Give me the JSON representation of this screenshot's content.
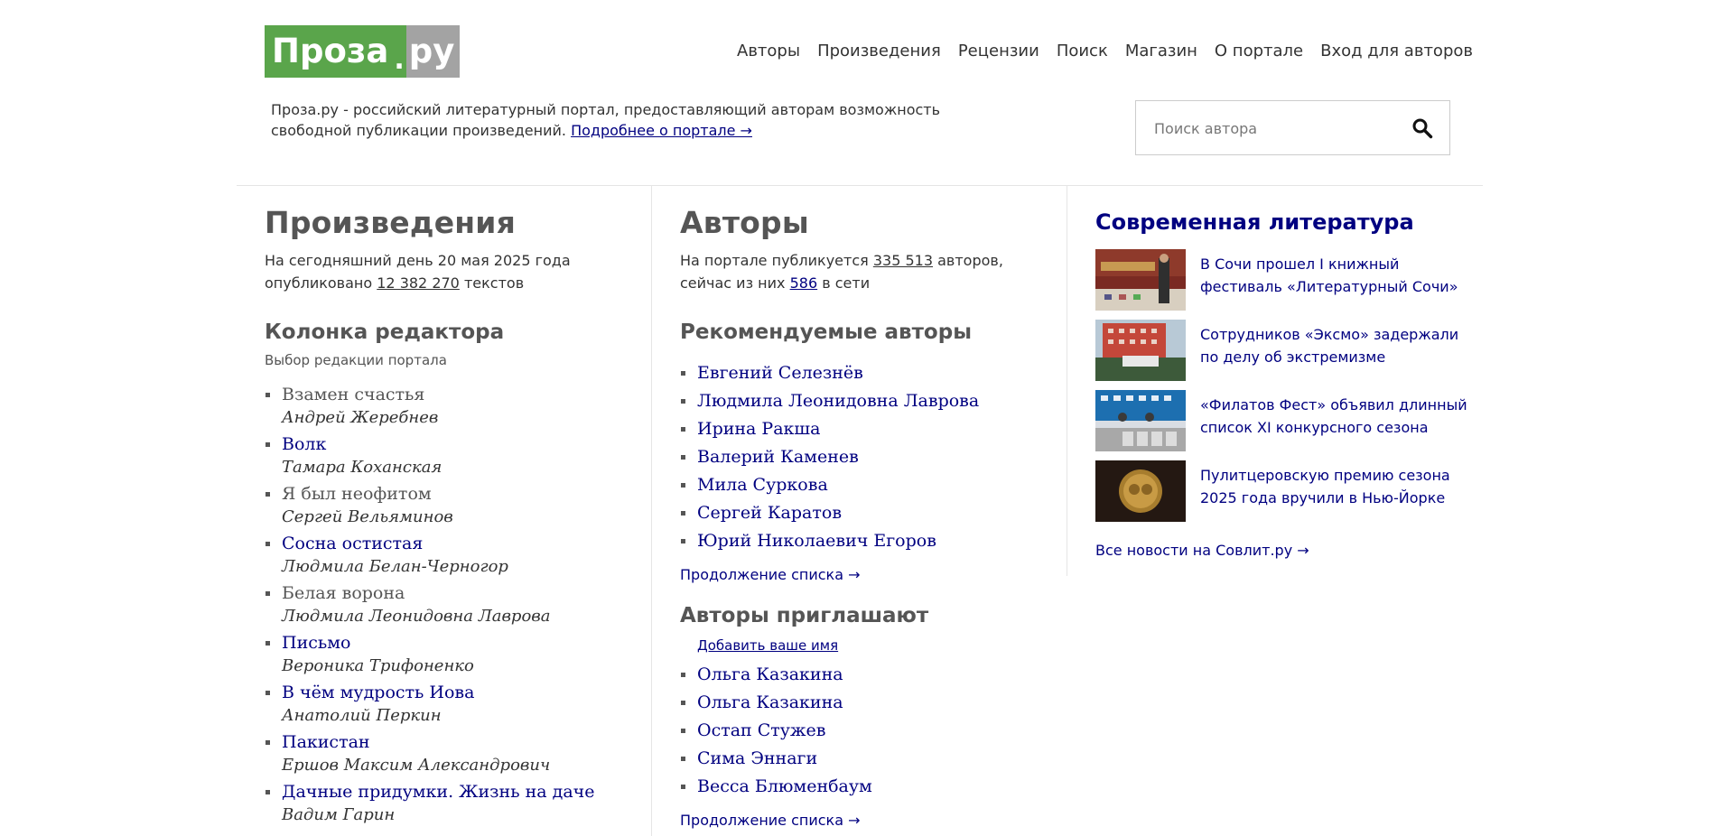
{
  "header": {
    "logo_main": "Проза",
    "logo_dot": ".",
    "logo_tld": "ру",
    "nav": [
      "Авторы",
      "Произведения",
      "Рецензии",
      "Поиск",
      "Магазин",
      "О портале",
      "Вход для авторов"
    ],
    "tagline": "Проза.ру - российский литературный портал, предоставляющий авторам возможность свободной публикации произведений.",
    "tagline_link": "Подробнее о портале →",
    "search_placeholder": "Поиск автора"
  },
  "works": {
    "title": "Произведения",
    "stat_prefix": "На сегодняшний день 20 мая 2025 года опубликовано",
    "stat_count": "12 382 270",
    "stat_suffix": "текстов",
    "editor_title": "Колонка редактора",
    "editor_note": "Выбор редакции портала",
    "items": [
      {
        "title": "Взамен счастья",
        "author": "Андрей Жеребнев",
        "visited": true
      },
      {
        "title": "Волк",
        "author": "Тамара Коханская",
        "visited": false
      },
      {
        "title": "Я был неофитом",
        "author": "Сергей Вельяминов",
        "visited": true
      },
      {
        "title": "Сосна остистая",
        "author": "Людмила Белан-Черногор",
        "visited": false
      },
      {
        "title": "Белая ворона",
        "author": "Людмила Леонидовна Лаврова",
        "visited": true
      },
      {
        "title": "Письмо",
        "author": "Вероника Трифоненко",
        "visited": false
      },
      {
        "title": "В чём мудрость Иова",
        "author": "Анатолий Перкин",
        "visited": false
      },
      {
        "title": "Пакистан",
        "author": "Ершов Максим Александрович",
        "visited": false
      },
      {
        "title": "Дачные придумки. Жизнь на даче",
        "author": "Вадим Гарин",
        "visited": false
      }
    ]
  },
  "authors": {
    "title": "Авторы",
    "stat_prefix": "На портале публикуется",
    "stat_count": "335 513",
    "stat_mid": "авторов,",
    "stat_mid2": "сейчас из них",
    "online": "586",
    "stat_suffix": "в сети",
    "recommended_title": "Рекомендуемые авторы",
    "recommended": [
      "Евгений Селезнёв",
      "Людмила Леонидовна Лаврова",
      "Ирина Ракша",
      "Валерий Каменев",
      "Мила Суркова",
      "Сергей Каратов",
      "Юрий Николаевич Егоров"
    ],
    "more_label": "Продолжение списка →",
    "invite_title": "Авторы приглашают",
    "add_name": "Добавить ваше имя",
    "invited": [
      "Ольга Казакина",
      "Ольга Казакина",
      "Остап Стужев",
      "Сима Эннаги",
      "Весса Блюменбаум"
    ],
    "more_label2": "Продолжение списка →"
  },
  "news": {
    "title": "Современная литература",
    "items": [
      {
        "text": "В Сочи прошел I книжный фестиваль «Литературный Сочи»",
        "thumb": "festival-stage-image"
      },
      {
        "text": "Сотрудников «Эксмо» задержали по делу об экстремизме",
        "thumb": "office-building-image"
      },
      {
        "text": "«Филатов Фест» объявил длинный список XI конкурсного сезона",
        "thumb": "press-conference-image"
      },
      {
        "text": "Пулитцеровскую премию сезона 2025 года вручили в Нью-Йорке",
        "thumb": "gold-medal-image"
      }
    ],
    "all_label": "Все новости на Совлит.ру →"
  }
}
